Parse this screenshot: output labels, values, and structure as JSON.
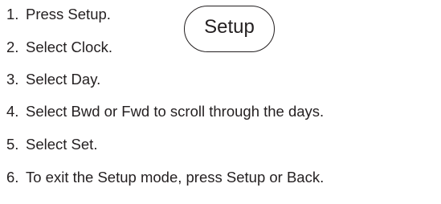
{
  "steps": [
    {
      "number": "1.",
      "text": "Press Setup."
    },
    {
      "number": "2.",
      "text": "Select Clock."
    },
    {
      "number": "3.",
      "text": "Select Day."
    },
    {
      "number": "4.",
      "text": "Select Bwd or Fwd to scroll through the days."
    },
    {
      "number": "5.",
      "text": "Select Set."
    },
    {
      "number": "6.",
      "text": "To exit the Setup mode, press Setup or Back."
    }
  ],
  "setup_key": {
    "label": "Setup"
  }
}
